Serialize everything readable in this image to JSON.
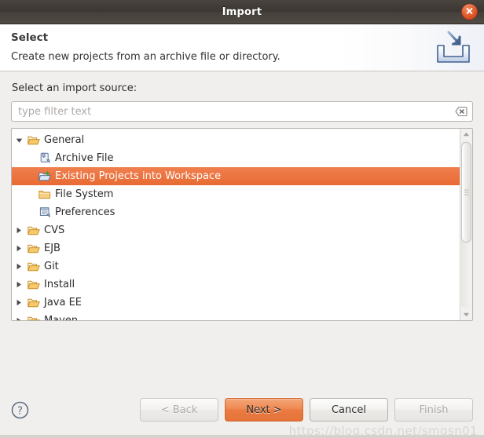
{
  "window": {
    "title": "Import",
    "close_label": "×"
  },
  "header": {
    "title": "Select",
    "description": "Create new projects from an archive file or directory.",
    "icon": "import-arrow-into-tray-icon"
  },
  "main": {
    "source_label": "Select an import source:",
    "filter": {
      "value": "",
      "placeholder": "type filter text",
      "clear_icon": "clear-field-icon"
    },
    "tree": {
      "items": [
        {
          "label": "General",
          "level": 0,
          "expanded": true,
          "icon": "open-folder-icon",
          "selected": false
        },
        {
          "label": "Archive File",
          "level": 1,
          "expanded": null,
          "icon": "archive-file-icon",
          "selected": false
        },
        {
          "label": "Existing Projects into Workspace",
          "level": 1,
          "expanded": null,
          "icon": "import-project-folder-icon",
          "selected": true
        },
        {
          "label": "File System",
          "level": 1,
          "expanded": null,
          "icon": "closed-folder-icon",
          "selected": false
        },
        {
          "label": "Preferences",
          "level": 1,
          "expanded": null,
          "icon": "preferences-page-icon",
          "selected": false
        },
        {
          "label": "CVS",
          "level": 0,
          "expanded": false,
          "icon": "open-folder-icon",
          "selected": false
        },
        {
          "label": "EJB",
          "level": 0,
          "expanded": false,
          "icon": "open-folder-icon",
          "selected": false
        },
        {
          "label": "Git",
          "level": 0,
          "expanded": false,
          "icon": "open-folder-icon",
          "selected": false
        },
        {
          "label": "Install",
          "level": 0,
          "expanded": false,
          "icon": "open-folder-icon",
          "selected": false
        },
        {
          "label": "Java EE",
          "level": 0,
          "expanded": false,
          "icon": "open-folder-icon",
          "selected": false
        },
        {
          "label": "Maven",
          "level": 0,
          "expanded": false,
          "icon": "open-folder-icon",
          "selected": false
        }
      ]
    }
  },
  "footer": {
    "help_icon": "help-question-icon",
    "buttons": [
      {
        "label": "< Back",
        "state": "disabled",
        "primary": false
      },
      {
        "label": "Next >",
        "state": "enabled",
        "primary": true
      },
      {
        "label": "Cancel",
        "state": "enabled",
        "primary": false
      },
      {
        "label": "Finish",
        "state": "disabled",
        "primary": false
      }
    ]
  },
  "watermark": "https://blog.csdn.net/smgsn01",
  "colors": {
    "titlebar": "#3c3733",
    "close_button": "#e0562a",
    "selection": "#e86a33",
    "primary_button": "#ea7b42",
    "dialog_background": "#f0efee",
    "folder_icon": "#f0b352"
  }
}
